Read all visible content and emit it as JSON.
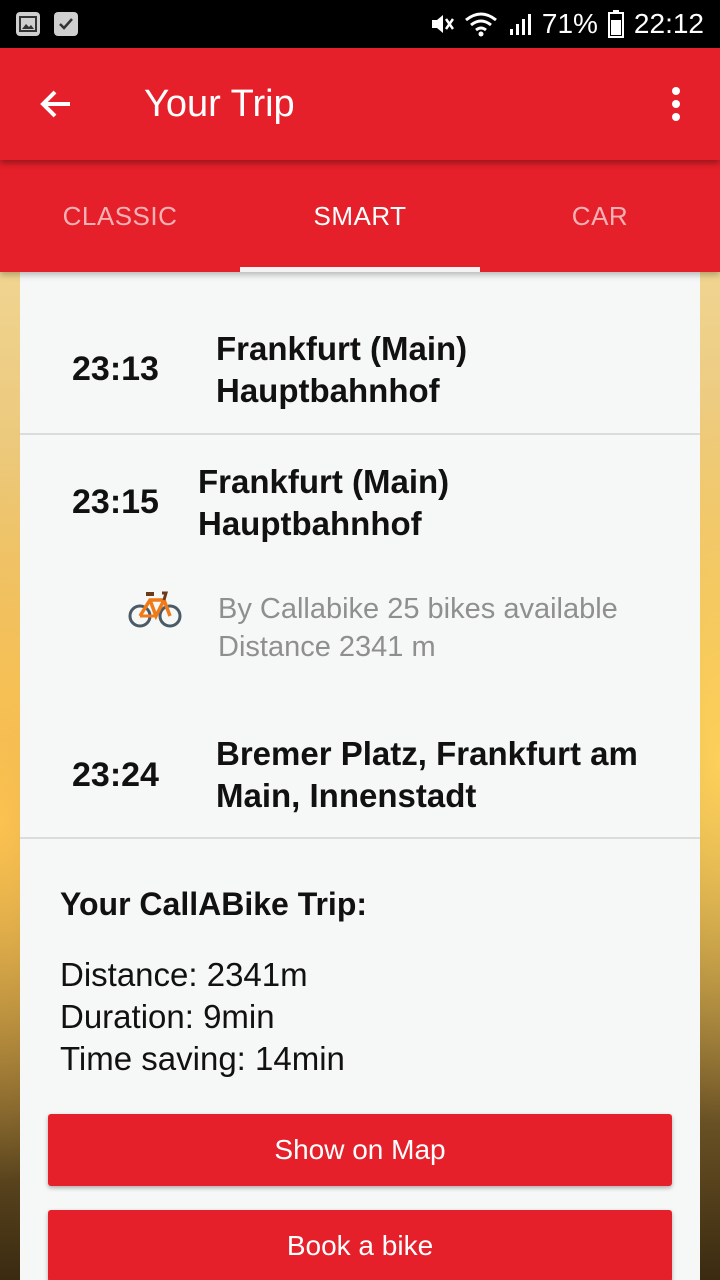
{
  "status_bar": {
    "battery": "71%",
    "time": "22:12"
  },
  "app_bar": {
    "title": "Your Trip"
  },
  "tabs": [
    {
      "label": "CLASSIC",
      "active": false
    },
    {
      "label": "SMART",
      "active": true
    },
    {
      "label": "CAR",
      "active": false
    }
  ],
  "stops": [
    {
      "time": "23:13",
      "name_line1": "Frankfurt (Main)",
      "name_line2": "Hauptbahnhof"
    },
    {
      "time": "23:15",
      "name_line1": "Frankfurt (Main)",
      "name_line2": "Hauptbahnhof"
    },
    {
      "time": "23:24",
      "name_line1": "Bremer Platz, Frankfurt am",
      "name_line2": "Main, Innenstadt"
    }
  ],
  "bike_segment": {
    "line1": "By Callabike 25 bikes available",
    "line2": "Distance 2341 m"
  },
  "summary": {
    "title": "Your CallABike Trip:",
    "distance": "Distance: 2341m",
    "duration": "Duration: 9min",
    "time_saving": "Time saving: 14min"
  },
  "buttons": {
    "show_on_map": "Show on Map",
    "book_bike": "Book a bike"
  },
  "colors": {
    "primary": "#e5202a",
    "card_bg": "#f6f7f7",
    "muted_text": "#8f8f8f"
  }
}
